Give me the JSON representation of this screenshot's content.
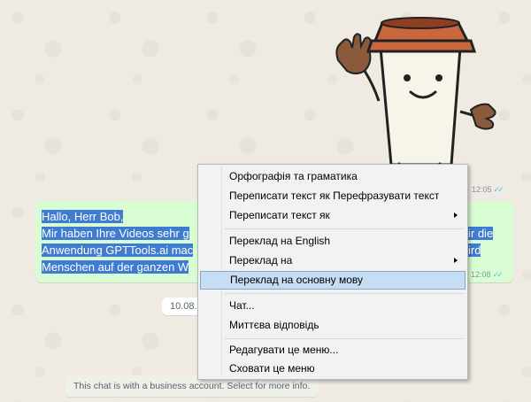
{
  "chat": {
    "sticker_time": "12:05",
    "message_lines": [
      "Hallo, Herr Bob,",
      "Mir haben Ihre Videos sehr g",
      "Anwendung GPTTools.ai mac",
      "Menschen auf der ganzen W"
    ],
    "message_right_fragments": [
      "ir die",
      "ird"
    ],
    "message_time": "12:08",
    "date_label": "10.08.",
    "business_notice": "This chat is with a business account. Select for more info."
  },
  "context_menu": {
    "items": [
      {
        "label": "Орфографія та граматика",
        "submenu": false
      },
      {
        "label": "Переписати текст як Перефразувати текст",
        "submenu": false
      },
      {
        "label": "Переписати текст як",
        "submenu": true
      },
      {
        "label": "Переклад на English",
        "submenu": false
      },
      {
        "label": "Переклад на",
        "submenu": true
      },
      {
        "label": "Переклад на основну мову",
        "submenu": false,
        "highlighted": true
      },
      {
        "label": "Чат...",
        "submenu": false
      },
      {
        "label": "Миттєва відповідь",
        "submenu": false
      },
      {
        "label": "Редагувати це меню...",
        "submenu": false
      },
      {
        "label": "Сховати це меню",
        "submenu": false
      }
    ]
  },
  "colors": {
    "chat_background": "#efeae2",
    "outgoing_bubble": "#d9fdd3",
    "selection": "#3f7bd0",
    "menu_highlight": "#c7ddf2",
    "read_ticks": "#53bdeb"
  }
}
